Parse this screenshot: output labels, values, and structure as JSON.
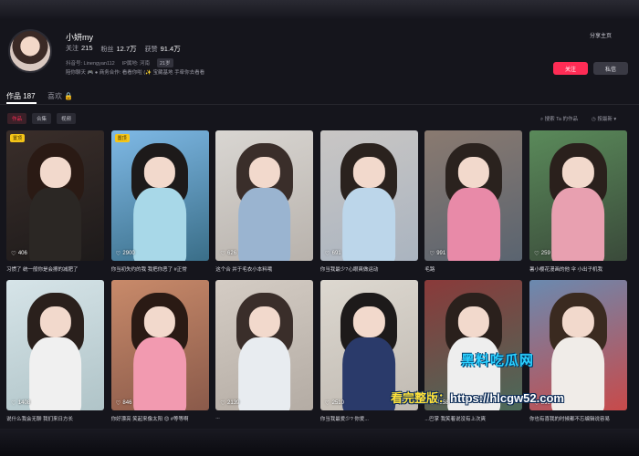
{
  "profile": {
    "name": "小妍my",
    "stats": [
      {
        "label": "关注",
        "value": "215"
      },
      {
        "label": "粉丝",
        "value": "12.7万"
      },
      {
        "label": "获赞",
        "value": "91.4万"
      }
    ],
    "id_text": "抖音号: Linengyan112",
    "ip_text": "IP属地: 河南",
    "age": "21岁",
    "bio": "陪你聊天 🎮 ● 商务合作: 看看你啦 (✨ 宝藏基地 手牵你去看看",
    "share_home": "分享主页",
    "follow_label": "关注",
    "message_label": "私信"
  },
  "tabs": {
    "works": "作品 187",
    "likes": "喜欢 🔒"
  },
  "filters": {
    "chips": [
      "作品",
      "合集",
      "视频"
    ],
    "search": "搜索 Ta 的作品",
    "sort": "按最新 ▾"
  },
  "videos": [
    {
      "likes": "406",
      "caption": "习惯了 统一般你是会擦的减肥了",
      "badge": "置顶",
      "colors": [
        "#3a2e2a",
        "#1d1a1a",
        "#2a1a14",
        "#2b2724"
      ]
    },
    {
      "likes": "2900",
      "caption": "你当初失约的我 我把你恶了 #正常",
      "badge": "置顶",
      "colors": [
        "#7fb9e6",
        "#3a6e88",
        "#1d1a1a",
        "#a8d8e8"
      ]
    },
    {
      "likes": "626",
      "caption": "这个合 并于毛衣小本料哦",
      "badge": "",
      "colors": [
        "#d9d6d2",
        "#b8b2ac",
        "#3a2e2a",
        "#9ab4d0"
      ]
    },
    {
      "likes": "691",
      "caption": "你当我最少?心眼爽做运动",
      "badge": "",
      "colors": [
        "#c9c6c4",
        "#aab4c0",
        "#2a221e",
        "#bcd6ea"
      ]
    },
    {
      "likes": "991",
      "caption": "毛路",
      "badge": "",
      "colors": [
        "#8a7a70",
        "#5a6470",
        "#2a221e",
        "#e88aa8"
      ]
    },
    {
      "likes": "259",
      "caption": "暑小樱花漫画的他 伞 小出子机我",
      "badge": "",
      "colors": [
        "#5a8a5a",
        "#3a4a3a",
        "#2a201c",
        "#e8a0b0"
      ]
    },
    {
      "likes": "1408",
      "caption": "说什么我会无聊 我们来日方长",
      "badge": "",
      "colors": [
        "#d6e4e8",
        "#b0c4c8",
        "#2a201c",
        "#f0f0f0"
      ]
    },
    {
      "likes": "846",
      "caption": "你好漂亮 笑起来像太阳 😊 #等等啊",
      "badge": "",
      "colors": [
        "#c88a6a",
        "#8a5a4a",
        "#2a1a14",
        "#f29ab0"
      ]
    },
    {
      "likes": "2139",
      "caption": "...",
      "badge": "",
      "colors": [
        "#d4ccc4",
        "#b4aca4",
        "#3a2e2a",
        "#e8ecf0"
      ]
    },
    {
      "likes": "2510",
      "caption": "你当我最爱少? 你爱...",
      "badge": "",
      "colors": [
        "#ddd8d0",
        "#c0bab2",
        "#1d1a1a",
        "#2a3a6a"
      ]
    },
    {
      "likes": "8858",
      "caption": "...巴掌 我笑着说没有上次爽",
      "badge": "",
      "colors": [
        "#8a3a3a",
        "#4a6a5a",
        "#2a201c",
        "#eeeeee"
      ]
    },
    {
      "likes": "866",
      "caption": "你也有喜我的时候都不忘编辑说容易",
      "badge": "",
      "colors": [
        "#6a8ab0",
        "#c84a4a",
        "#3a2a20",
        "#f0ece8"
      ]
    }
  ],
  "watermark": {
    "logo": "黑料吃瓜网",
    "url_prefix": "看完整版：",
    "url": "https://hlcgw52.com"
  }
}
